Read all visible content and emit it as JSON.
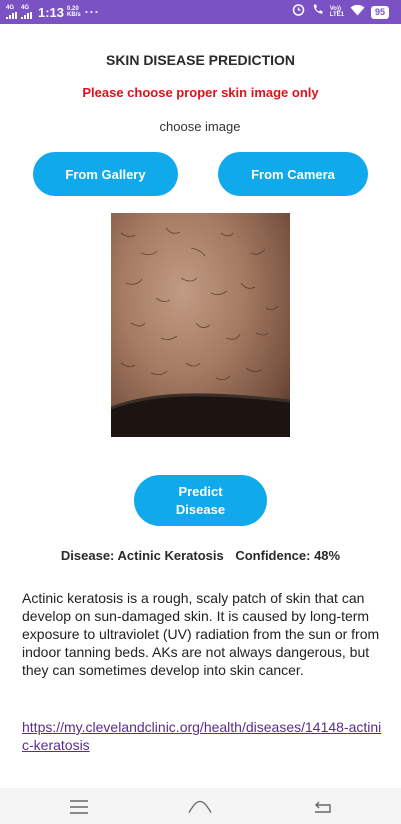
{
  "status_bar": {
    "network1": "4G",
    "network2": "4G",
    "time": "1:13",
    "speed_value": "0.20",
    "speed_unit": "KB/s",
    "overflow": "···",
    "lte_top": "Vo))",
    "lte_bottom": "LTE1",
    "battery": "95"
  },
  "header": {
    "title": "SKIN DISEASE PREDICTION",
    "warning": "Please choose proper skin image only",
    "choose_label": "choose image"
  },
  "buttons": {
    "gallery": "From Gallery",
    "camera": "From Camera",
    "predict": "Predict Disease"
  },
  "result": {
    "disease": "Disease: Actinic Keratosis",
    "confidence": "Confidence: 48%"
  },
  "description": "Actinic keratosis is a rough, scaly patch of skin that can develop on sun-damaged skin. It is caused by long-term exposure to ultraviolet (UV) radiation from the sun or from indoor tanning beds. AKs are not always dangerous, but they can sometimes develop into skin cancer.",
  "link": "https://my.clevelandclinic.org/health/diseases/14148-actinic-keratosis",
  "nav": {
    "menu_icon": "menu-icon",
    "home_icon": "home-icon",
    "back_icon": "back-icon"
  },
  "colors": {
    "status_bar": "#7a52c4",
    "button": "#0fa9ec",
    "warning": "#e0101a",
    "link": "#5b2d8c"
  }
}
